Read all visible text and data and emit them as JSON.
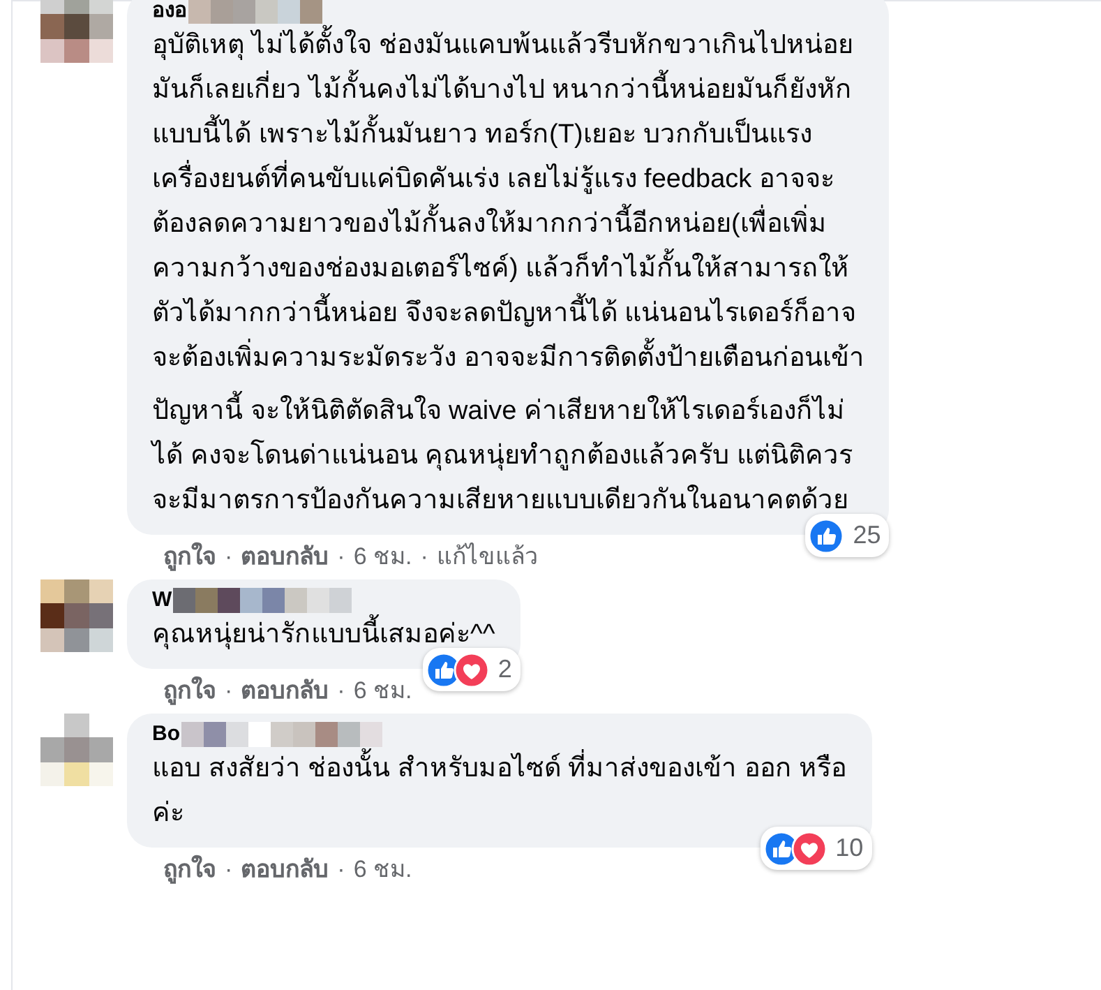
{
  "comments": [
    {
      "author": "องอ",
      "separator": "·",
      "paragraphs": [
        [
          "อุบัติเหตุ ไม่ได้ตั้งใจ ช่องมันแคบพ้นแล้วรีบหักขวาเกินไปหน่อย",
          "มันก็เลยเกี่ยว ไม้กั้นคงไม่ได้บางไป หนากว่านี้หน่อยมันก็ยังหัก",
          "แบบนี้ได้ เพราะไม้กั้นมันยาว ทอร์ก(T)เยอะ บวกกับเป็นแรง",
          "เครื่องยนต์ที่คนขับแค่บิดคันเร่ง เลยไม่รู้แรง feedback อาจจะ",
          "ต้องลดความยาวของไม้กั้นลงให้มากกว่านี้อีกหน่อย(เพื่อเพิ่ม",
          "ความกว้างของช่องมอเตอร์ไซค์) แล้วก็ทำไม้กั้นให้สามารถให้",
          "ตัวได้มากกว่านี้หน่อย จึงจะลดปัญหานี้ได้ แน่นอนไรเดอร์ก็อาจ",
          "จะต้องเพิ่มความระมัดระวัง อาจจะมีการติดตั้งป้ายเตือนก่อนเข้า"
        ],
        [
          "ปัญหานี้ จะให้นิติตัดสินใจ waive ค่าเสียหายให้ไรเดอร์เองก็ไม่",
          "ได้ คงจะโดนด่าแน่นอน คุณหนุ่ยทำถูกต้องแล้วครับ แต่นิติควร",
          "จะมีมาตรการป้องกันความเสียหายแบบเดียวกันในอนาคตด้วย"
        ]
      ],
      "reactions": [
        {
          "kind": "like"
        }
      ],
      "reaction_count": "25",
      "actions": [
        {
          "label": "ถูกใจ",
          "kind": "link"
        },
        {
          "label": "ตอบกลับ",
          "kind": "link"
        },
        {
          "label": "6 ชม.",
          "kind": "meta"
        },
        {
          "label": "แก้ไขแล้ว",
          "kind": "meta"
        }
      ]
    },
    {
      "author": "W",
      "separator": "·",
      "paragraphs": [
        [
          "คุณหนุ่ยน่ารักแบบนี้เสมอค่ะ^^"
        ]
      ],
      "reactions": [
        {
          "kind": "like"
        },
        {
          "kind": "love"
        }
      ],
      "reaction_count": "2",
      "actions": [
        {
          "label": "ถูกใจ",
          "kind": "link"
        },
        {
          "label": "ตอบกลับ",
          "kind": "link"
        },
        {
          "label": "6 ชม.",
          "kind": "meta"
        }
      ]
    },
    {
      "author": "Bo",
      "separator": "·",
      "paragraphs": [
        [
          "แอบ สงสัยว่า ช่องนั้น สำหรับมอไซด์ ที่มาส่งของเข้า ออก หรือ",
          "ค่ะ"
        ]
      ],
      "reactions": [
        {
          "kind": "like"
        },
        {
          "kind": "love"
        }
      ],
      "reaction_count": "10",
      "actions": [
        {
          "label": "ถูกใจ",
          "kind": "link"
        },
        {
          "label": "ตอบกลับ",
          "kind": "link"
        },
        {
          "label": "6 ชม.",
          "kind": "meta"
        }
      ]
    }
  ]
}
